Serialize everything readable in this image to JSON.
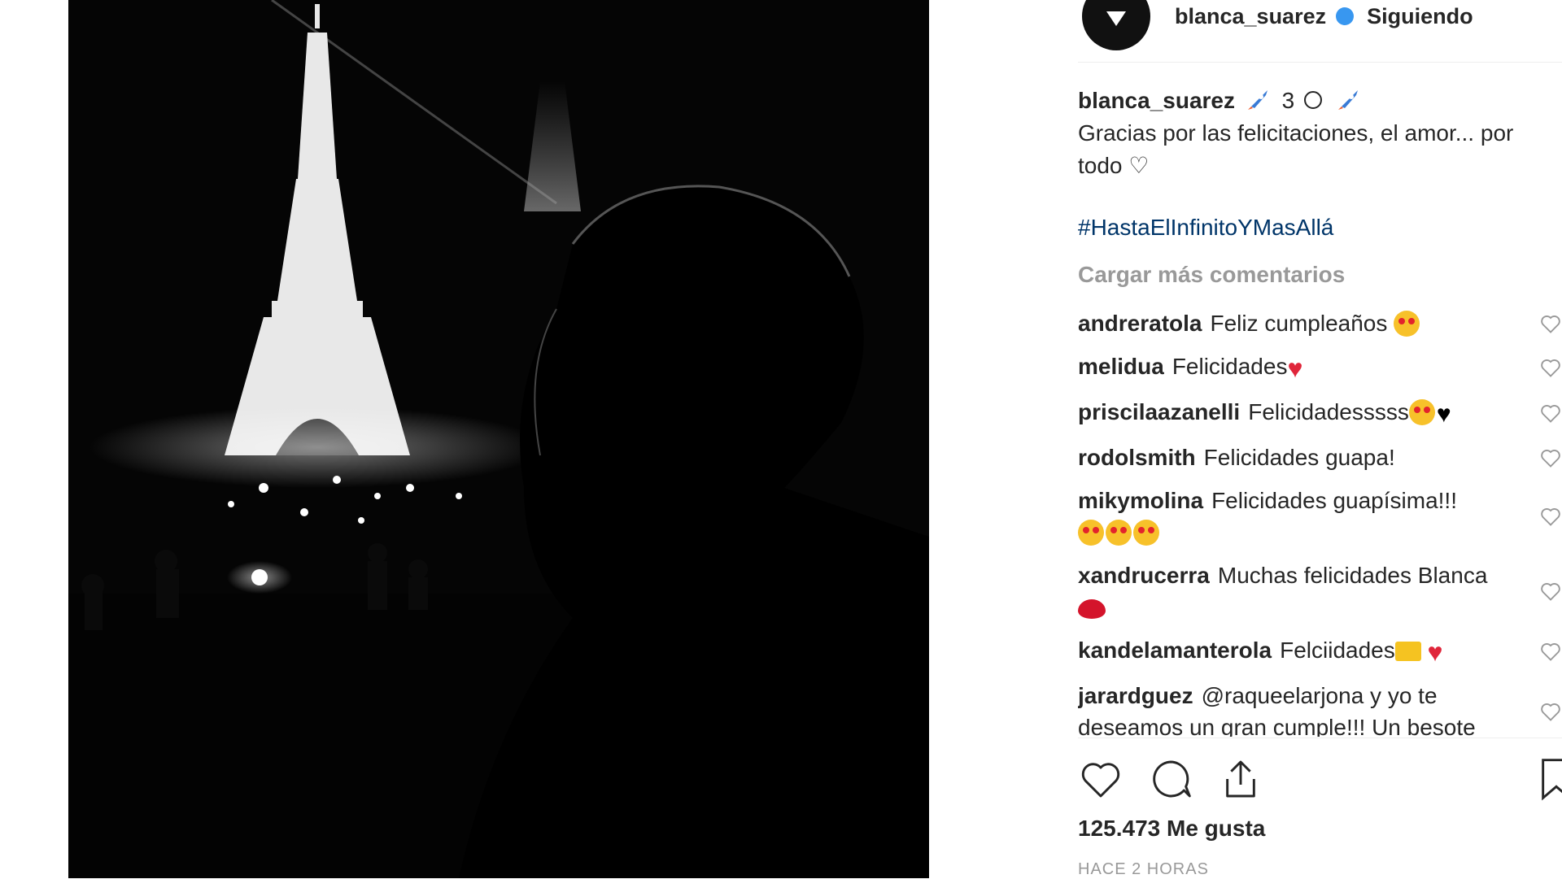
{
  "post": {
    "header": {
      "username": "blanca_suarez",
      "follow_status": "Siguiendo"
    },
    "caption": {
      "username": "blanca_suarez",
      "title_num": "3",
      "text": "Gracias por las felicitaciones, el amor... por todo ♡",
      "hashtag": "#HastaElInfinitoYMasAllá"
    },
    "load_more": "Cargar más comentarios",
    "comments": [
      {
        "user": "andreratola",
        "text": "Feliz cumpleaños"
      },
      {
        "user": "melidua",
        "text": "Felicidades"
      },
      {
        "user": "priscilaazanelli",
        "text": "Felicidadesssss"
      },
      {
        "user": "rodolsmith",
        "text": "Felicidades guapa!"
      },
      {
        "user": "mikymolina",
        "text": "Felicidades guapísima!!!"
      },
      {
        "user": "xandrucerra",
        "text": "Muchas felicidades Blanca"
      },
      {
        "user": "kandelamanterola",
        "text": "Felciidades"
      },
      {
        "user": "jarardguez",
        "text": "@raqueelarjona y yo te deseamos un gran cumple!!! Un besote"
      }
    ],
    "likes": "125.473 Me gusta",
    "time": "HACE 2 HORAS"
  },
  "colors": {
    "link": "#003569",
    "muted": "#999999",
    "verified": "#3897f0"
  },
  "icons": [
    "like-icon",
    "comment-icon",
    "share-icon",
    "save-icon",
    "rocket-emoji",
    "heart-eyes-emoji"
  ]
}
